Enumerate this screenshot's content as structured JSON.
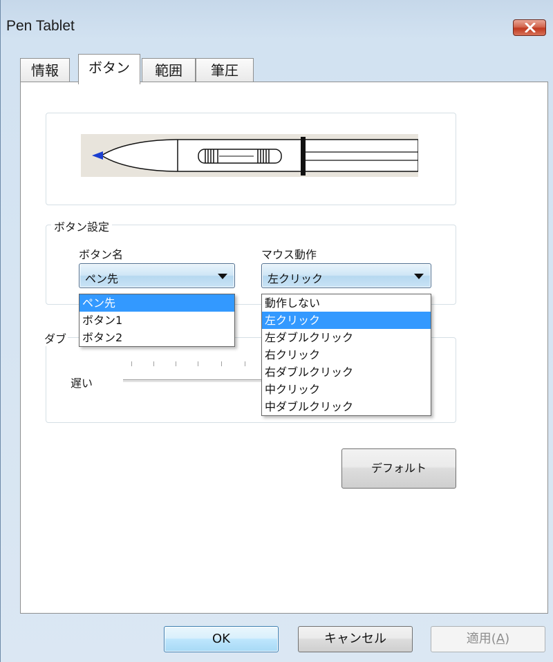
{
  "window": {
    "title": "Pen Tablet"
  },
  "tabs": [
    {
      "label": "情報",
      "active": false
    },
    {
      "label": "ボタン",
      "active": true
    },
    {
      "label": "範囲",
      "active": false
    },
    {
      "label": "筆圧",
      "active": false
    }
  ],
  "button_settings": {
    "group_label": "ボタン設定",
    "button_name_label": "ボタン名",
    "mouse_action_label": "マウス動作",
    "button_name_value": "ペン先",
    "mouse_action_value": "左クリック",
    "button_name_options": [
      "ペン先",
      "ボタン1",
      "ボタン2"
    ],
    "mouse_action_options": [
      "動作しない",
      "左クリック",
      "左ダブルクリック",
      "右クリック",
      "右ダブルクリック",
      "中クリック",
      "中ダブルクリック"
    ]
  },
  "double_click": {
    "group_label_partial": "ダブ",
    "slow_label": "遅い"
  },
  "buttons": {
    "default": "デフォルト",
    "ok": "OK",
    "cancel": "キャンセル",
    "apply": "適用(",
    "apply_mnemonic": "A",
    "apply_suffix": ")"
  },
  "colors": {
    "selection": "#3399ff",
    "pen_tip": "#1b3fd1",
    "close_button": "#c7432a"
  },
  "icons": {
    "close": "close-x-icon",
    "dropdown": "chevron-down-icon"
  }
}
